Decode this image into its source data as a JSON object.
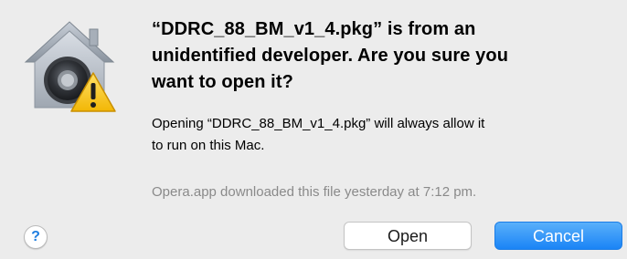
{
  "dialog": {
    "title_lines": [
      "“DDRC_88_BM_v1_4.pkg” is from an",
      "unidentified developer. Are you sure you",
      "want to open it?"
    ],
    "body_lines": [
      "Opening “DDRC_88_BM_v1_4.pkg” will always allow it",
      "to run on this Mac."
    ],
    "source_text": "Opera.app downloaded this file yesterday at 7:12 pm.",
    "help_label": "?",
    "buttons": {
      "open_label": "Open",
      "cancel_label": "Cancel"
    },
    "icon": "gatekeeper-warning-icon"
  },
  "colors": {
    "background": "#ececec",
    "secondary_text": "#8a8a8a",
    "help_accent": "#1f7ee0",
    "default_button": "#1a84f6",
    "warning_yellow": "#f5c51e"
  }
}
